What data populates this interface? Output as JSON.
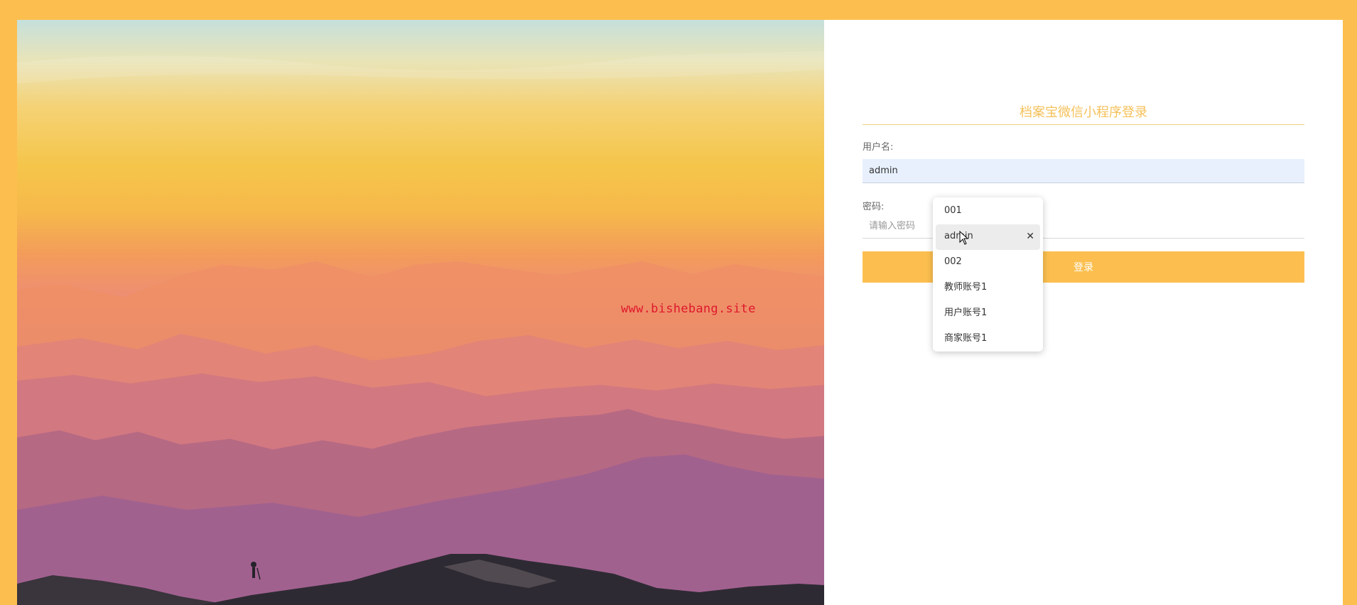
{
  "colors": {
    "accent": "#fcbf4f",
    "title": "#f5c15a",
    "watermark": "#e0172a",
    "autofill_bg": "#e8f0fe"
  },
  "hero": {
    "watermark": "www.bishebang.site"
  },
  "login": {
    "title": "档案宝微信小程序登录",
    "username_label": "用户名:",
    "username_value": "admin",
    "password_label": "密码:",
    "password_placeholder": "请输入密码",
    "submit_label": "登录"
  },
  "autocomplete": {
    "items": [
      {
        "label": "001",
        "highlighted": false
      },
      {
        "label": "admin",
        "highlighted": true
      },
      {
        "label": "002",
        "highlighted": false
      },
      {
        "label": "教师账号1",
        "highlighted": false
      },
      {
        "label": "用户账号1",
        "highlighted": false
      },
      {
        "label": "商家账号1",
        "highlighted": false
      }
    ],
    "remove_icon": "close-icon"
  }
}
